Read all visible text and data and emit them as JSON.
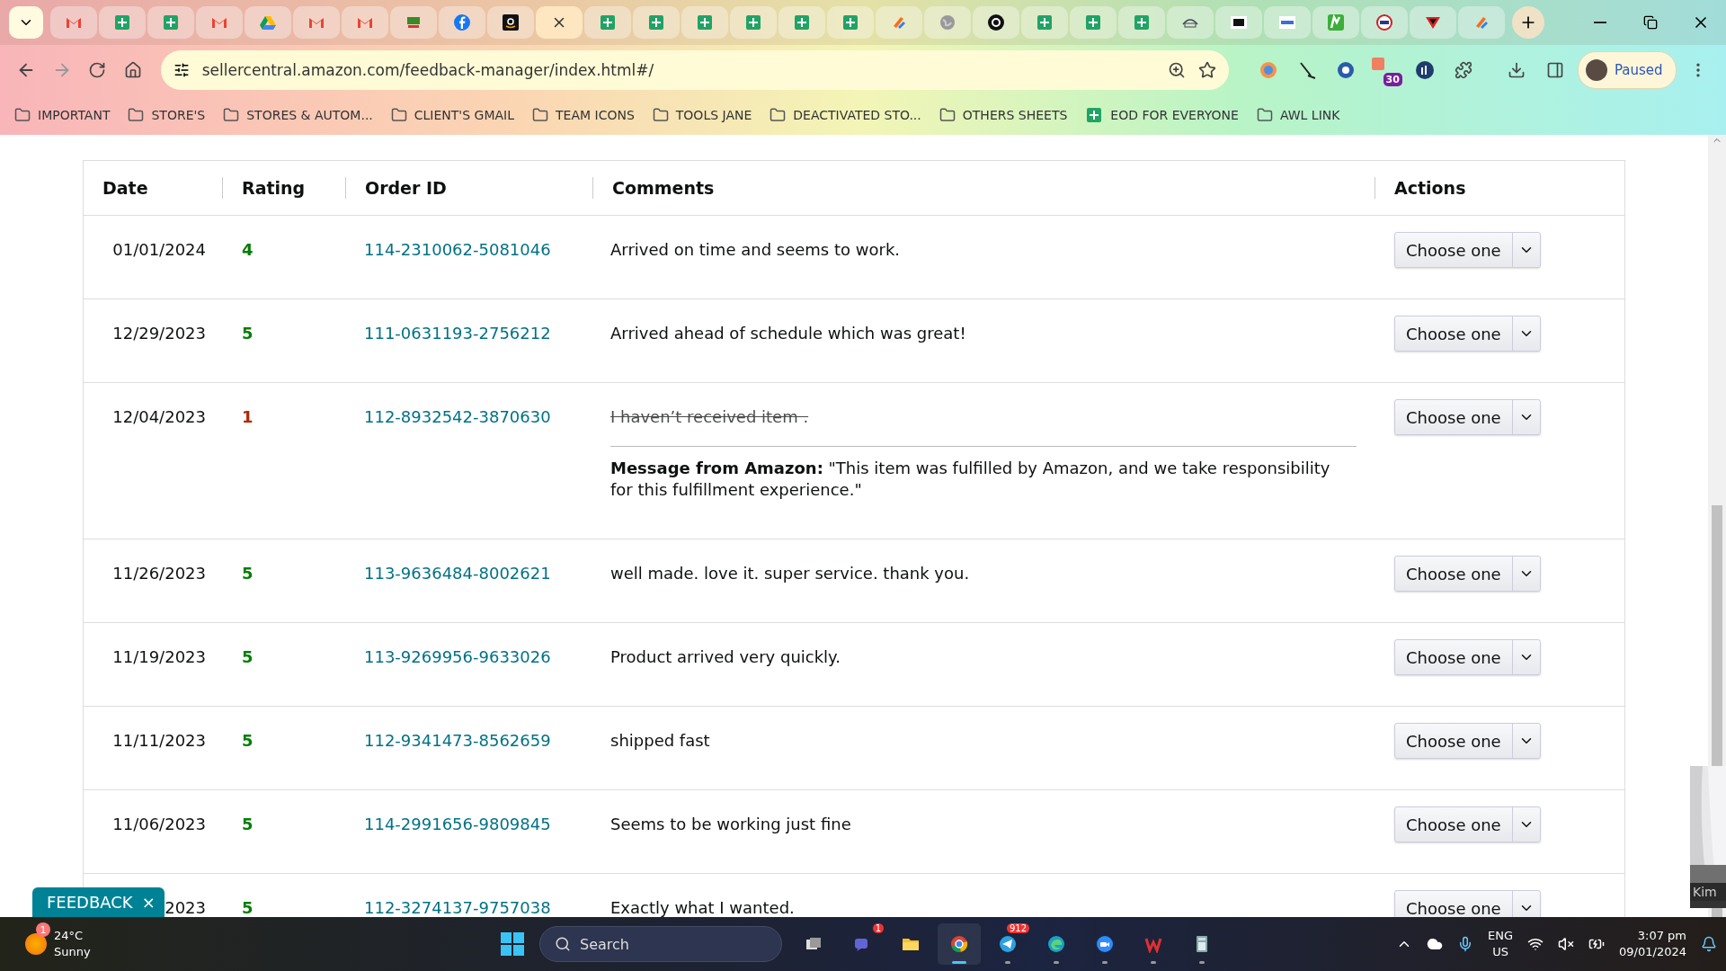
{
  "browser": {
    "tabs": [
      {
        "kind": "gmail",
        "selected": false
      },
      {
        "kind": "sheets",
        "selected": false
      },
      {
        "kind": "sheets",
        "selected": false
      },
      {
        "kind": "gmail",
        "selected": false
      },
      {
        "kind": "drive",
        "selected": false
      },
      {
        "kind": "gmail",
        "selected": false
      },
      {
        "kind": "gmail",
        "selected": false
      },
      {
        "kind": "foods",
        "selected": false
      },
      {
        "kind": "facebook",
        "selected": false
      },
      {
        "kind": "amazon",
        "selected": false
      },
      {
        "selected": true
      },
      {
        "kind": "sheets",
        "selected": false
      },
      {
        "kind": "sheets",
        "selected": false
      },
      {
        "kind": "sheets",
        "selected": false
      },
      {
        "kind": "sheets",
        "selected": false
      },
      {
        "kind": "sheets",
        "selected": false
      },
      {
        "kind": "sheets",
        "selected": false
      },
      {
        "kind": "tasks",
        "selected": false
      },
      {
        "kind": "globe",
        "selected": false
      },
      {
        "kind": "dark-circle",
        "selected": false
      },
      {
        "kind": "sheets",
        "selected": false
      },
      {
        "kind": "sheets",
        "selected": false
      },
      {
        "kind": "sheets",
        "selected": false
      },
      {
        "kind": "outline-logo",
        "selected": false
      },
      {
        "kind": "dark-square",
        "selected": false
      },
      {
        "kind": "light-square",
        "selected": false
      },
      {
        "kind": "green-stripe",
        "selected": false
      },
      {
        "kind": "ring",
        "selected": false
      },
      {
        "kind": "red-triangle",
        "selected": false
      },
      {
        "kind": "tasks",
        "selected": false
      }
    ],
    "url": "sellercentral.amazon.com/feedback-manager/index.html#/",
    "extension_badge": "30",
    "profile": "Paused",
    "bookmarks": [
      {
        "kind": "folder",
        "label": "IMPORTANT"
      },
      {
        "kind": "folder",
        "label": "STORE'S"
      },
      {
        "kind": "folder",
        "label": "STORES & AUTOM..."
      },
      {
        "kind": "folder",
        "label": "CLIENT'S GMAIL"
      },
      {
        "kind": "folder",
        "label": "TEAM ICONS"
      },
      {
        "kind": "folder",
        "label": "TOOLS JANE"
      },
      {
        "kind": "folder",
        "label": "DEACTIVATED STO..."
      },
      {
        "kind": "folder",
        "label": "OTHERS SHEETS"
      },
      {
        "kind": "sheet",
        "label": "EOD FOR EVERYONE"
      },
      {
        "kind": "folder",
        "label": "AWL LINK"
      }
    ]
  },
  "table": {
    "columns": [
      "Date",
      "Rating",
      "Order ID",
      "Comments",
      "Actions"
    ],
    "rows": [
      {
        "date": "01/01/2024",
        "rating": "4",
        "color": "#067d06",
        "order_id": "114-2310062-5081046",
        "comment": "Arrived on time and seems to work.",
        "struck": false,
        "action": "Choose one"
      },
      {
        "date": "12/29/2023",
        "rating": "5",
        "color": "#067d06",
        "order_id": "111-0631193-2756212",
        "comment": "Arrived ahead of schedule which was great!",
        "struck": false,
        "action": "Choose one"
      },
      {
        "date": "12/04/2023",
        "rating": "1",
        "color": "#b12704",
        "order_id": "112-8932542-3870630",
        "comment": "I haven’t received item .",
        "struck": true,
        "note": "**Message from Amazon:** \"This item was fulfilled by Amazon, and we take responsibility for this fulfillment experience.\"",
        "action": "Choose one"
      },
      {
        "date": "11/26/2023",
        "rating": "5",
        "color": "#067d06",
        "order_id": "113-9636484-8002621",
        "comment": "well made. love it. super service. thank you.",
        "struck": false,
        "action": "Choose one"
      },
      {
        "date": "11/19/2023",
        "rating": "5",
        "color": "#067d06",
        "order_id": "113-9269956-9633026",
        "comment": "Product arrived very quickly.",
        "struck": false,
        "action": "Choose one"
      },
      {
        "date": "11/11/2023",
        "rating": "5",
        "color": "#067d06",
        "order_id": "112-9341473-8562659",
        "comment": "shipped fast",
        "struck": false,
        "action": "Choose one"
      },
      {
        "date": "11/06/2023",
        "rating": "5",
        "color": "#067d06",
        "order_id": "114-2991656-9809845",
        "comment": "Seems to be working just fine",
        "struck": false,
        "action": "Choose one"
      },
      {
        "date": "2023",
        "rating": "5",
        "color": "#067d06",
        "order_id": "112-3274137-9757038",
        "comment": "Exactly what I wanted.",
        "struck": false,
        "action": "Choose one"
      }
    ]
  },
  "feedback_tab": {
    "label": "FEEDBACK",
    "close": "×"
  },
  "video_overlay": {
    "caption": "Kim"
  },
  "taskbar": {
    "weather": {
      "temp": "24°C",
      "condition": "Sunny",
      "badge": "1"
    },
    "search": "Search",
    "apps": [
      {
        "kind": "taskview",
        "running": false,
        "selected": false
      },
      {
        "kind": "chat",
        "running": false,
        "selected": false,
        "badge": "1"
      },
      {
        "kind": "files",
        "running": false,
        "selected": false
      },
      {
        "kind": "chrome",
        "running": true,
        "selected": true
      },
      {
        "kind": "telegram",
        "running": true,
        "selected": false,
        "badge": "912"
      },
      {
        "kind": "edge",
        "running": true,
        "selected": false
      },
      {
        "kind": "zoom",
        "running": true,
        "selected": false
      },
      {
        "kind": "wps",
        "running": true,
        "selected": false
      },
      {
        "kind": "calculator",
        "running": true,
        "selected": false
      }
    ],
    "language": "ENG",
    "region": "US",
    "time": "3:07 pm",
    "date": "09/01/2024"
  }
}
